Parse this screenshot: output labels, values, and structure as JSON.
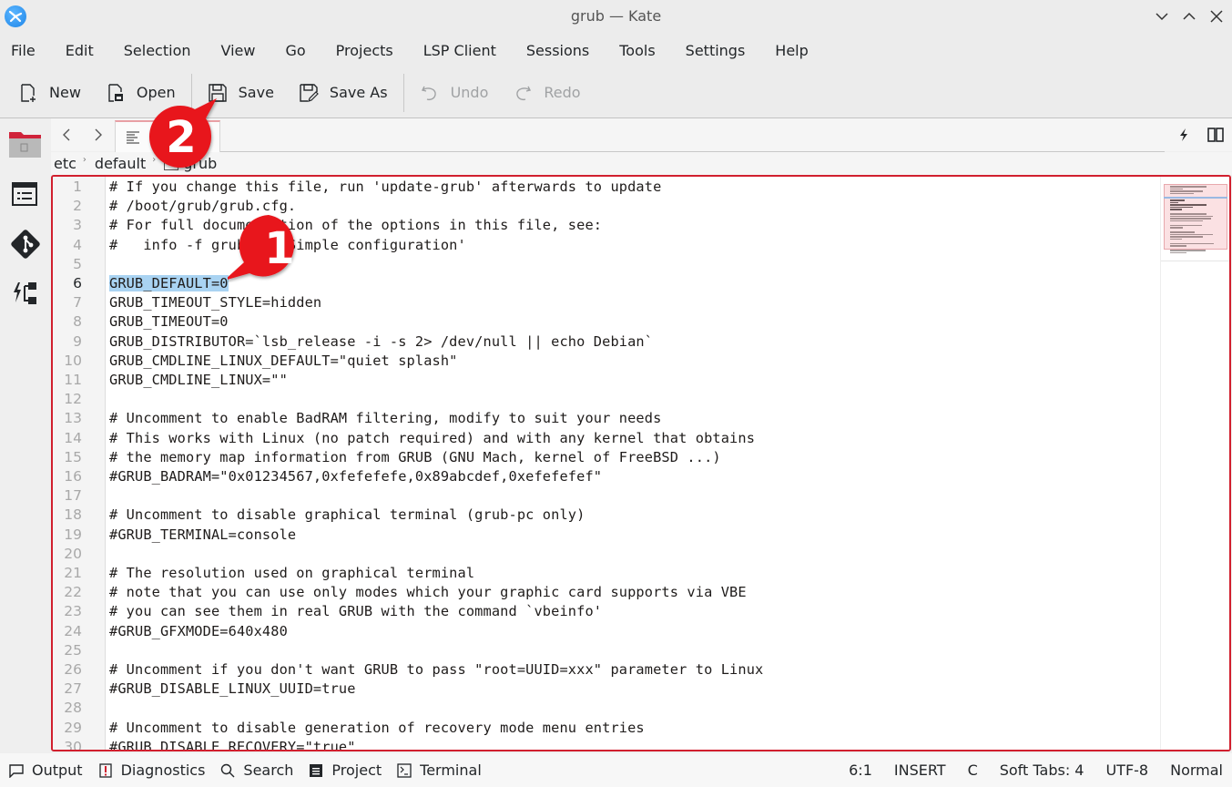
{
  "window": {
    "title": "grub — Kate",
    "controls": [
      "minimize",
      "maximize",
      "close"
    ]
  },
  "menubar": {
    "items": [
      "File",
      "Edit",
      "Selection",
      "View",
      "Go",
      "Projects",
      "LSP Client",
      "Sessions",
      "Tools",
      "Settings",
      "Help"
    ]
  },
  "toolbar": {
    "new_label": "New",
    "open_label": "Open",
    "save_label": "Save",
    "save_as_label": "Save As",
    "undo_label": "Undo",
    "redo_label": "Redo"
  },
  "breadcrumb": {
    "items": [
      "etc",
      "default",
      "grub"
    ]
  },
  "editor": {
    "current_line": 6,
    "selected_text": "GRUB_DEFAULT=0",
    "lines": [
      "# If you change this file, run 'update-grub' afterwards to update",
      "# /boot/grub/grub.cfg.",
      "# For full documentation of the options in this file, see:",
      "#   info -f grub -n 'Simple configuration'",
      "",
      "GRUB_DEFAULT=0",
      "GRUB_TIMEOUT_STYLE=hidden",
      "GRUB_TIMEOUT=0",
      "GRUB_DISTRIBUTOR=`lsb_release -i -s 2> /dev/null || echo Debian`",
      "GRUB_CMDLINE_LINUX_DEFAULT=\"quiet splash\"",
      "GRUB_CMDLINE_LINUX=\"\"",
      "",
      "# Uncomment to enable BadRAM filtering, modify to suit your needs",
      "# This works with Linux (no patch required) and with any kernel that obtains",
      "# the memory map information from GRUB (GNU Mach, kernel of FreeBSD ...)",
      "#GRUB_BADRAM=\"0x01234567,0xfefefefe,0x89abcdef,0xefefefef\"",
      "",
      "# Uncomment to disable graphical terminal (grub-pc only)",
      "#GRUB_TERMINAL=console",
      "",
      "# The resolution used on graphical terminal",
      "# note that you can use only modes which your graphic card supports via VBE",
      "# you can see them in real GRUB with the command `vbeinfo'",
      "#GRUB_GFXMODE=640x480",
      "",
      "# Uncomment if you don't want GRUB to pass \"root=UUID=xxx\" parameter to Linux",
      "#GRUB_DISABLE_LINUX_UUID=true",
      "",
      "# Uncomment to disable generation of recovery mode menu entries",
      "#GRUB_DISABLE_RECOVERY=\"true\""
    ]
  },
  "statusbar": {
    "tools": [
      {
        "label": "Output",
        "icon": "output-icon"
      },
      {
        "label": "Diagnostics",
        "icon": "diagnostics-icon"
      },
      {
        "label": "Search",
        "icon": "search-icon"
      },
      {
        "label": "Project",
        "icon": "project-icon"
      },
      {
        "label": "Terminal",
        "icon": "terminal-icon"
      }
    ],
    "cursor_position": "6:1",
    "input_mode": "INSERT",
    "language": "C",
    "indentation": "Soft Tabs: 4",
    "encoding": "UTF-8",
    "mode": "Normal"
  },
  "annotations": {
    "marker_1": "1",
    "marker_2": "2",
    "color": "#e8141c"
  }
}
